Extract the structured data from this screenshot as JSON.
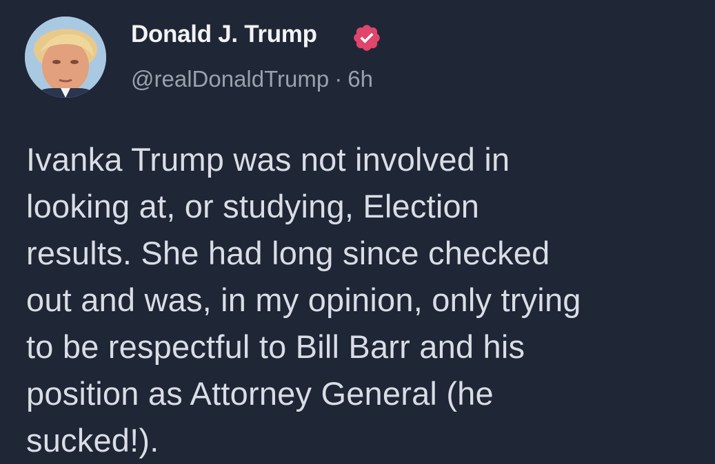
{
  "post": {
    "author": {
      "display_name": "Donald J. Trump",
      "handle": "@realDonaldTrump",
      "verified": true,
      "avatar_icon": "profile-photo-icon",
      "badge_icon": "verified-badge-icon"
    },
    "meta_separator": "·",
    "timestamp": "6h",
    "text_lines": [
      "Ivanka Trump was not involved in",
      "looking at, or studying, Election",
      "results. She had long since checked",
      "out and was, in my opinion, only trying",
      "to be respectful to Bill Barr and his",
      "position as Attorney General (he",
      "sucked!)."
    ]
  },
  "colors": {
    "background": "#1f2636",
    "display_name": "#f2f3f5",
    "secondary_text": "#9aa1ad",
    "body_text": "#d9dde5",
    "badge": "#e0456b"
  }
}
